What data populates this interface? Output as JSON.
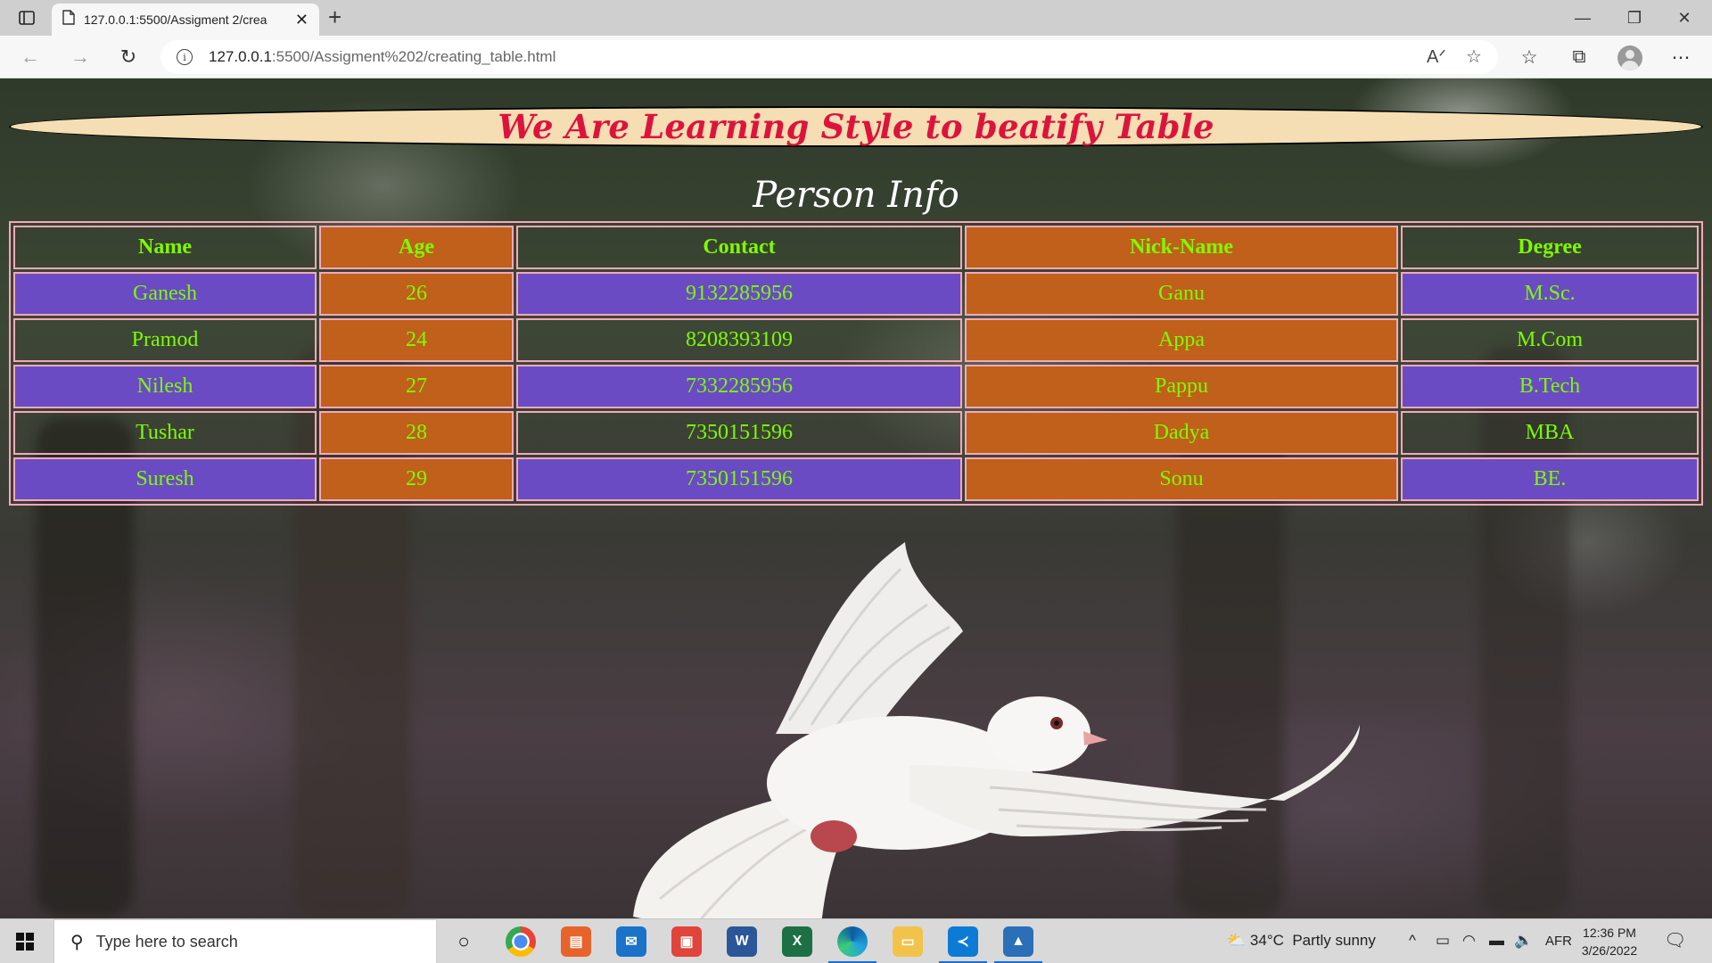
{
  "browser": {
    "tab_title": "127.0.0.1:5500/Assigment 2/crea",
    "url_host": "127.0.0.1",
    "url_rest": ":5500/Assigment%202/creating_table.html",
    "icons": [
      "tab-actions-icon",
      "page-icon",
      "close-icon",
      "new-tab-icon",
      "minimize-icon",
      "restore-icon",
      "window-close-icon",
      "back-icon",
      "forward-icon",
      "refresh-icon",
      "info-icon",
      "read-aloud-icon",
      "add-favorite-icon",
      "favorites-icon",
      "collections-icon",
      "profile-icon",
      "more-icon"
    ]
  },
  "page": {
    "banner_text": "We Are Learning Style to beatify Table",
    "caption": "Person Info",
    "table": {
      "headers": [
        "Name",
        "Age",
        "Contact",
        "Nick-Name",
        "Degree"
      ],
      "rows": [
        [
          "Ganesh",
          "26",
          "9132285956",
          "Ganu",
          "M.Sc."
        ],
        [
          "Pramod",
          "24",
          "8208393109",
          "Appa",
          "M.Com"
        ],
        [
          "Nilesh",
          "27",
          "7332285956",
          "Pappu",
          "B.Tech"
        ],
        [
          "Tushar",
          "28",
          "7350151596",
          "Dadya",
          "MBA"
        ],
        [
          "Suresh",
          "29",
          "7350151596",
          "Sonu",
          "BE."
        ]
      ]
    },
    "colors": {
      "banner_bg": "#f5deb3",
      "banner_text": "#dc143c",
      "cell_text": "#7cfc00",
      "orange_col": "#c0601a",
      "purple_row": "#6a4bc4",
      "border": "#f4a8b8"
    }
  },
  "taskbar": {
    "search_placeholder": "Type here to search",
    "weather": "34°C  Partly sunny",
    "language": "AFR",
    "time": "12:36 PM",
    "date": "3/26/2022",
    "apps": [
      "cortana-icon",
      "chrome-icon",
      "slides-icon",
      "mail-icon",
      "store-icon",
      "word-icon",
      "excel-icon",
      "edge-icon",
      "file-explorer-icon",
      "vscode-icon",
      "photos-icon"
    ]
  }
}
